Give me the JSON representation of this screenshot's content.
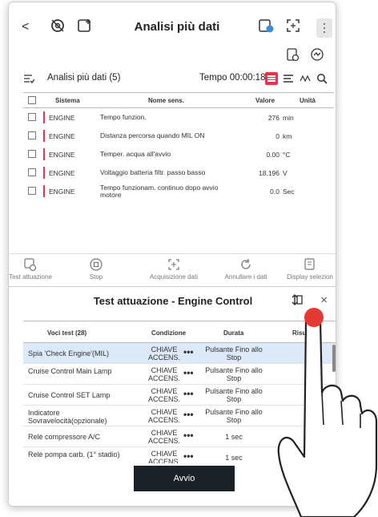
{
  "header": {
    "title": "Analisi più dati"
  },
  "data_panel": {
    "title": "Analisi più dati (5)",
    "time": "Tempo 00:00:18",
    "columns": [
      "Sistema",
      "Nome sens.",
      "Valore",
      "Unità"
    ],
    "rows": [
      {
        "system": "ENGINE",
        "name": "Tempo funzion.",
        "value": "276",
        "unit": "min"
      },
      {
        "system": "ENGINE",
        "name": "Distanza percorsa quando MIL ON",
        "value": "0",
        "unit": "km"
      },
      {
        "system": "ENGINE",
        "name": "Temper. acqua all'avvio",
        "value": "0.00",
        "unit": "°C"
      },
      {
        "system": "ENGINE",
        "name": "Voltaggio batteria filtr. passo basso",
        "value": "18.196",
        "unit": "V"
      },
      {
        "system": "ENGINE",
        "name": "Tempo funzionam. continuo dopo avvio motore",
        "value": "0.0",
        "unit": "Sec"
      }
    ]
  },
  "toolbar": {
    "items": [
      {
        "label": "Test attuazione"
      },
      {
        "label": "Stop"
      },
      {
        "label": "Acquisizione dati"
      },
      {
        "label": "Annullare i dati"
      },
      {
        "label": "Display selezion"
      }
    ]
  },
  "test_sheet": {
    "title": "Test attuazione  - Engine Control",
    "columns": [
      "Voci test (28)",
      "Condizione",
      "Durata",
      "Risultato"
    ],
    "rows": [
      {
        "name": "Spia 'Check Engine'(MIL)",
        "cond": "CHIAVE ACCENS.",
        "dur": "Pulsante Fino allo Stop",
        "selected": true
      },
      {
        "name": "Cruise Control Main Lamp",
        "cond": "CHIAVE ACCENS.",
        "dur": "Pulsante Fino allo Stop",
        "selected": false
      },
      {
        "name": "Cruise Control SET Lamp",
        "cond": "CHIAVE ACCENS.",
        "dur": "Pulsante Fino allo Stop",
        "selected": false
      },
      {
        "name": "Indicatore Sovravelocità(opzionale)",
        "cond": "CHIAVE ACCENS.",
        "dur": "Pulsante Fino allo Stop",
        "selected": false
      },
      {
        "name": "Relè compressore A/C",
        "cond": "CHIAVE ACCENS.",
        "dur": "1 sec",
        "selected": false
      },
      {
        "name": "Relè pompa carb. (1° stadio)",
        "cond": "CHIAVE ACCENS.",
        "dur": "1 sec",
        "selected": false
      }
    ],
    "more_label": "•••",
    "start_label": "Avvio"
  },
  "colors": {
    "accent": "#e8334a",
    "selected_row": "#dbe9f8",
    "start_button": "#1b2126",
    "touch": "#e53935"
  }
}
